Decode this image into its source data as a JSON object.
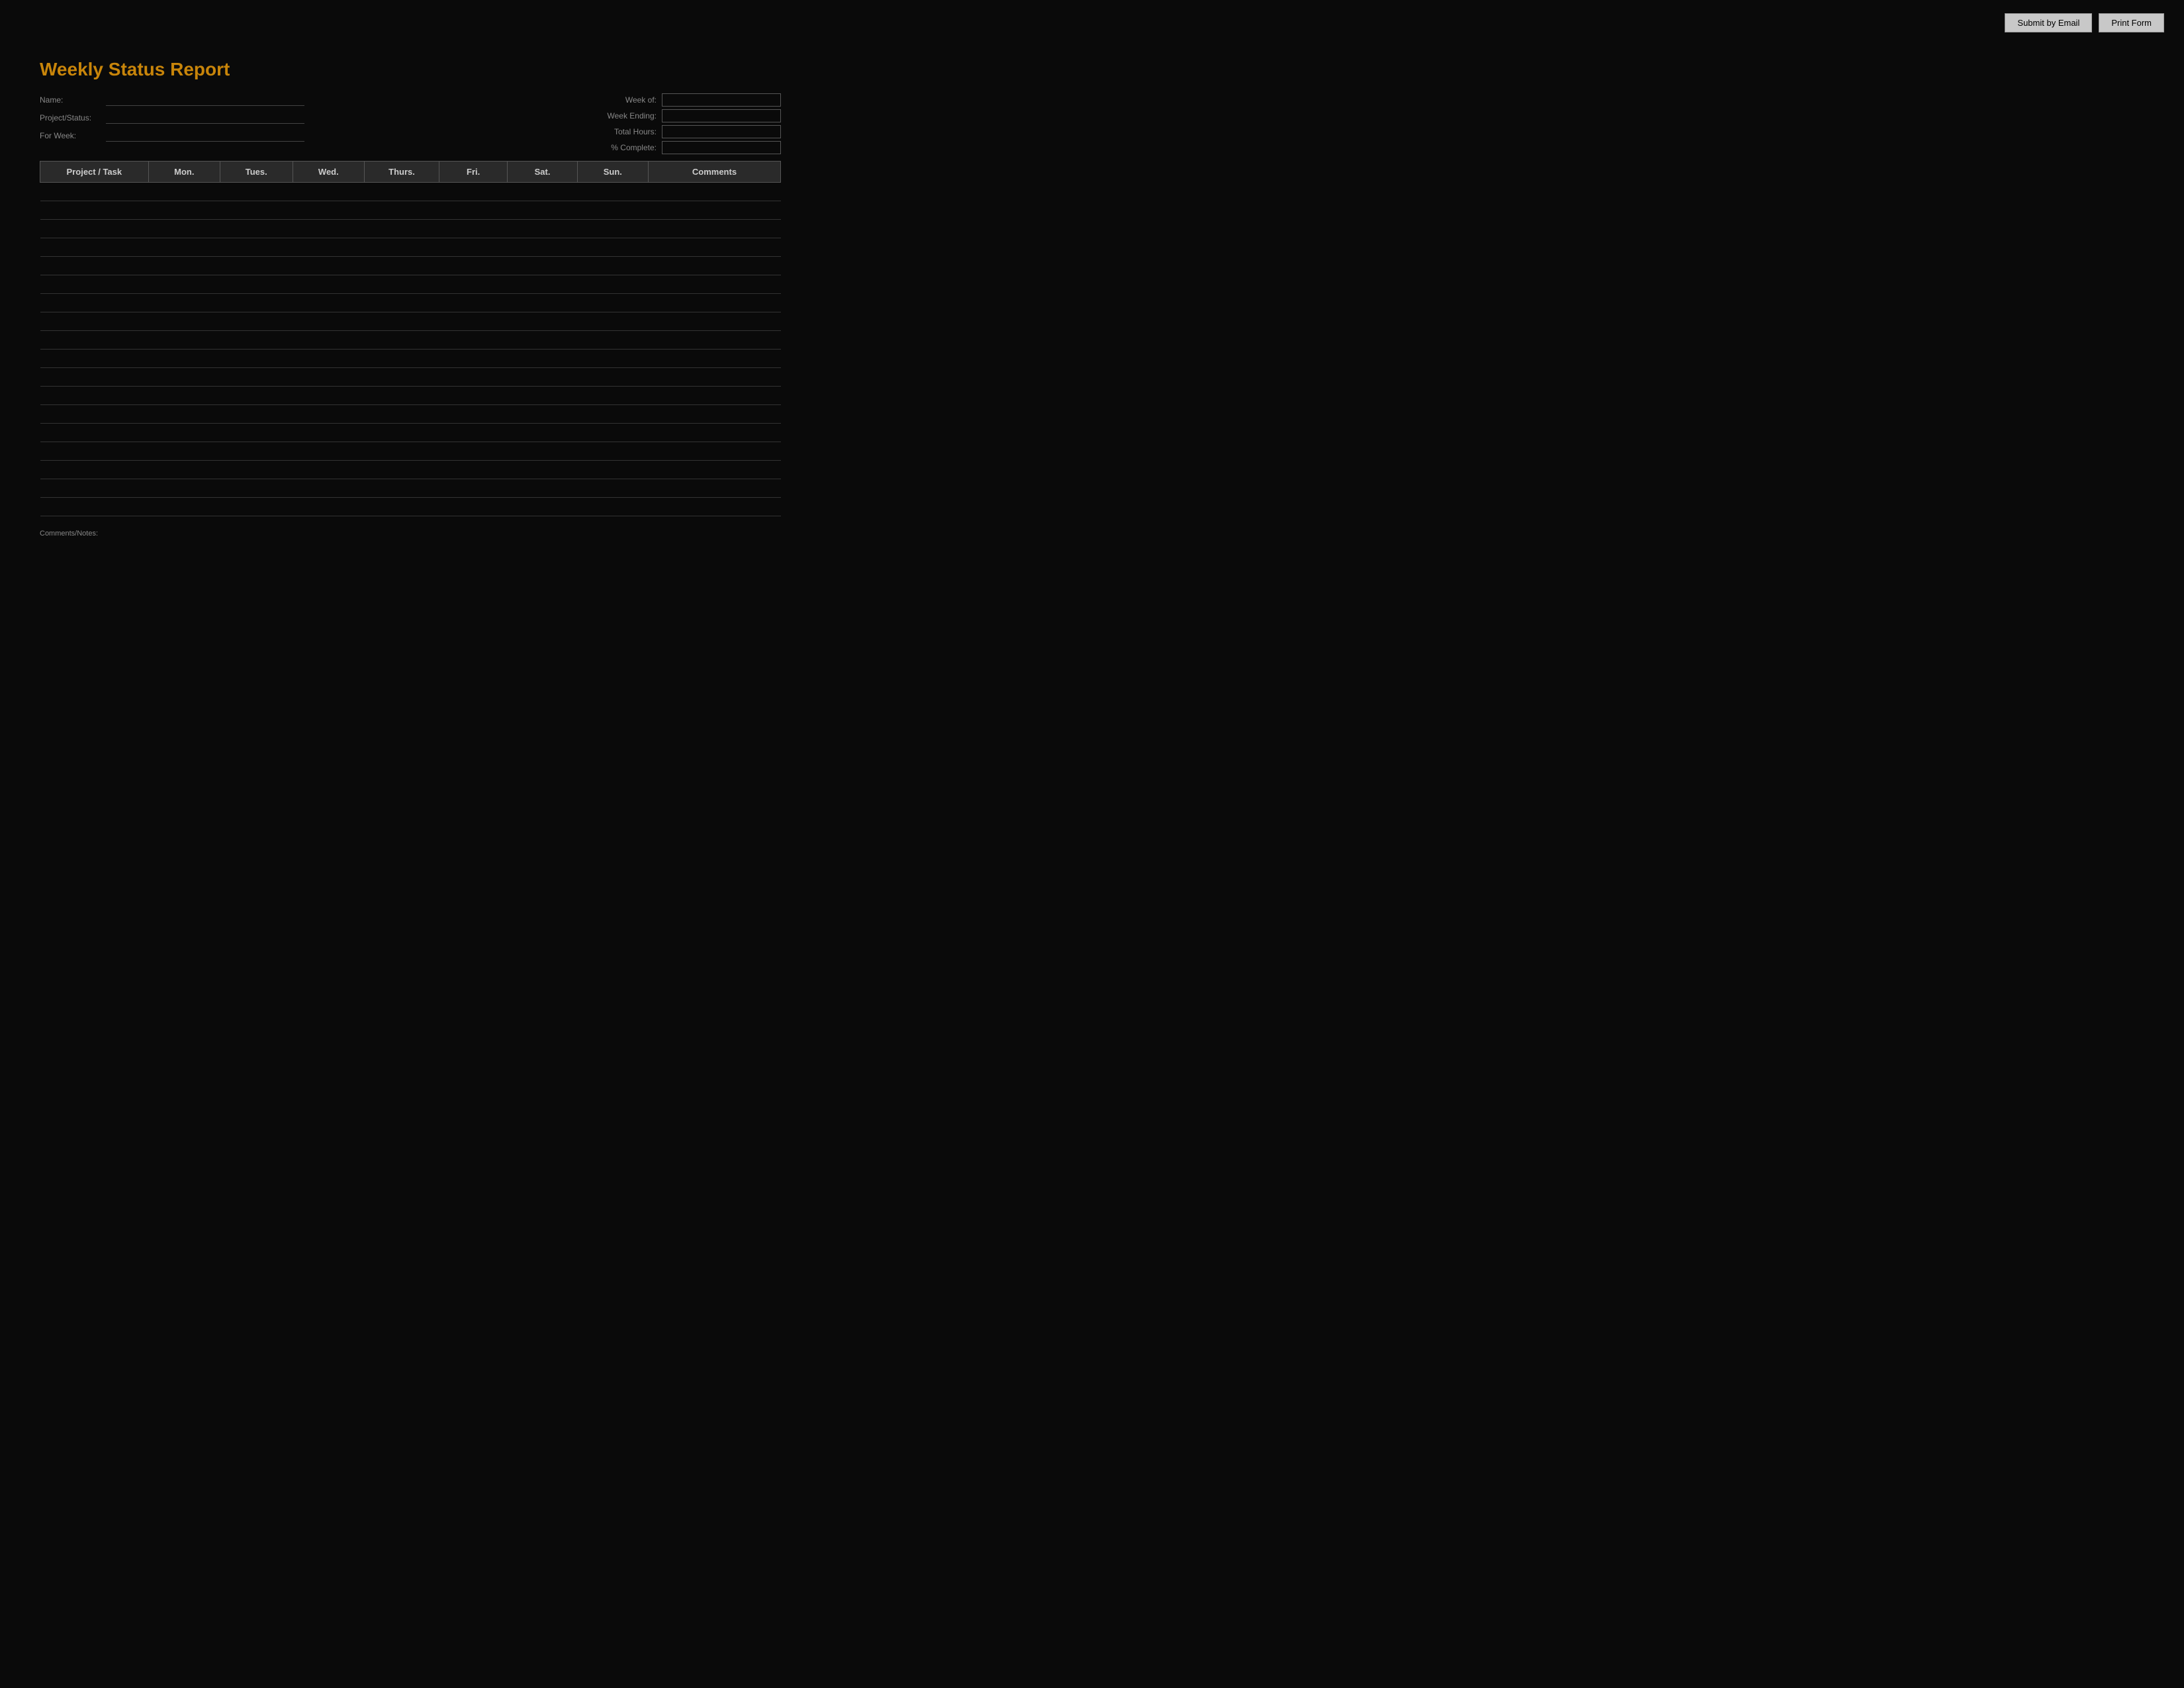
{
  "toolbar": {
    "submit_email_label": "Submit by Email",
    "print_form_label": "Print Form"
  },
  "form": {
    "title": "Weekly Status Report",
    "fields": {
      "name_label": "Name:",
      "name_value": "",
      "project_status_label": "Project/Status:",
      "project_status_value": "",
      "for_week_label": "For Week:",
      "for_week_value": "",
      "week_of_label": "Week of:",
      "week_of_value": "",
      "week_ending_label": "Week Ending:",
      "week_ending_value": "",
      "total_hours_label": "Total Hours:",
      "total_hours_value": "",
      "percent_complete_label": "% Complete:",
      "percent_complete_value": ""
    },
    "table": {
      "columns": [
        "Project / Task",
        "Mon.",
        "Tues.",
        "Wed.",
        "Thurs.",
        "Fri.",
        "Sat.",
        "Sun.",
        "Comments"
      ],
      "rows": 18
    },
    "bottom_label": "Comments/Notes:"
  }
}
